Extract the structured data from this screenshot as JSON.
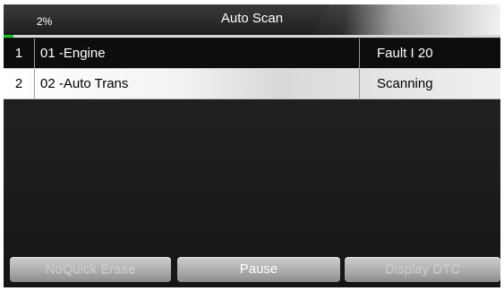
{
  "header": {
    "progress_label": "2%",
    "progress_value": 0.02,
    "title": "Auto Scan"
  },
  "rows": [
    {
      "index": "1",
      "name": "01 -Engine",
      "status": "Fault I 20"
    },
    {
      "index": "2",
      "name": "02 -Auto Trans",
      "status": "Scanning"
    }
  ],
  "buttons": {
    "quick_erase": "NoQuick Erase",
    "pause": "Pause",
    "display_dtc": "Display DTC"
  },
  "colors": {
    "progress": "#19c81e",
    "background": "#151515"
  }
}
